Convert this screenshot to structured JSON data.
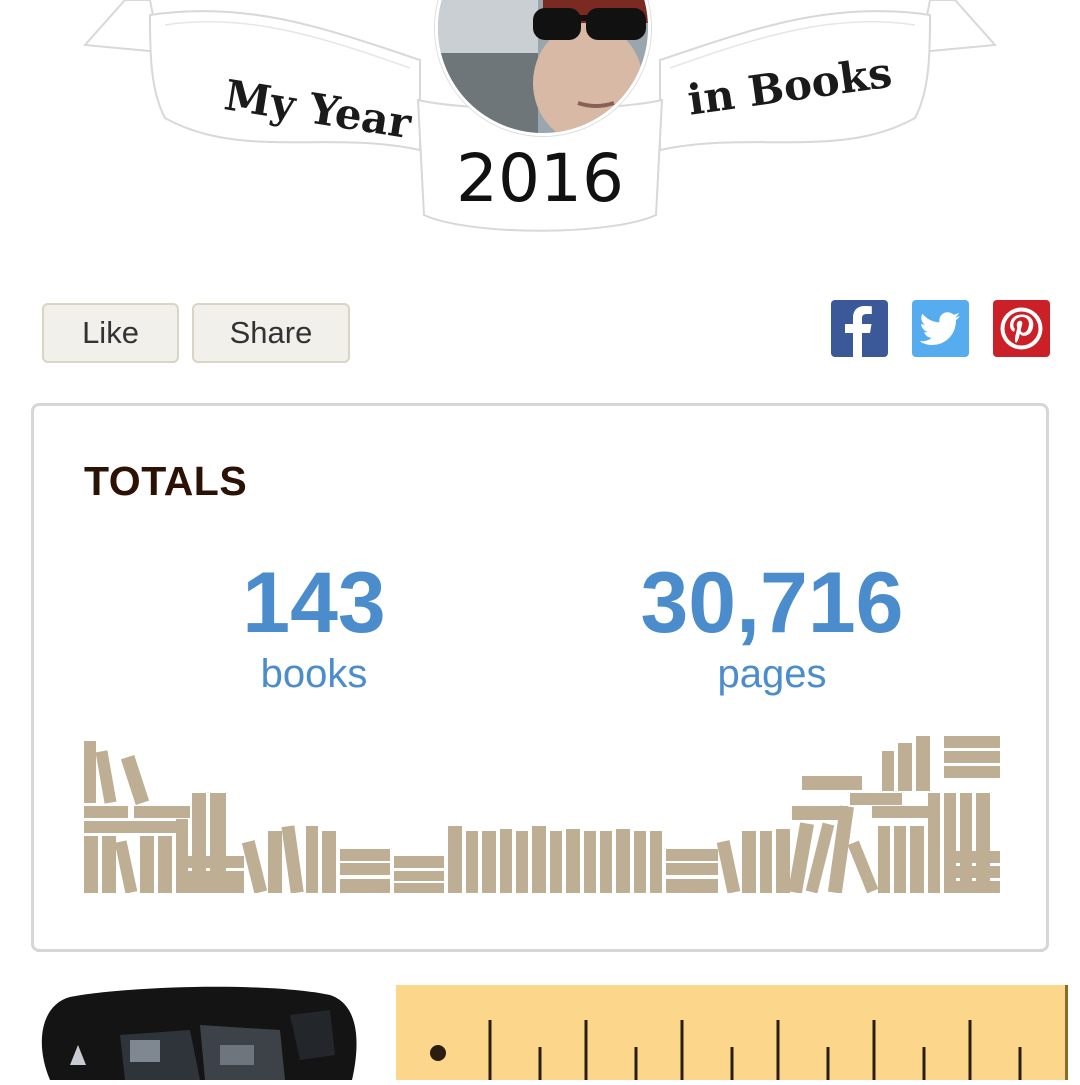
{
  "header": {
    "banner_left": "My Year",
    "banner_right": "in Books",
    "year": "2016"
  },
  "actions": {
    "like_label": "Like",
    "share_label": "Share",
    "social": [
      {
        "name": "facebook-icon",
        "color": "#3b5998"
      },
      {
        "name": "twitter-icon",
        "color": "#55acee"
      },
      {
        "name": "pinterest-icon",
        "color": "#cb2027"
      }
    ]
  },
  "totals": {
    "heading": "TOTALS",
    "books_count": "143",
    "books_label": "books",
    "pages_count": "30,716",
    "pages_label": "pages"
  },
  "colors": {
    "accent": "#4a8ccc",
    "shelf": "#bdae94",
    "ruler": "#fcd68a"
  }
}
